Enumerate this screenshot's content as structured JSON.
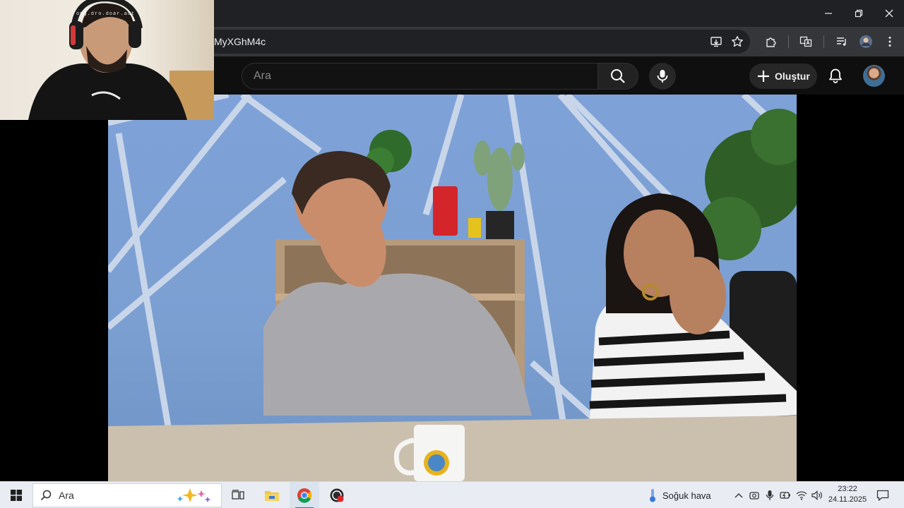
{
  "browser": {
    "url_visible": "MyXGhM4c"
  },
  "youtube": {
    "search_placeholder": "Ara",
    "create_label": "Oluştur"
  },
  "webcam": {
    "overlay_text": "ong.dro.doar.aut"
  },
  "taskbar": {
    "search_label": "Ara",
    "weather_label": "Soğuk hava",
    "time": "23:22",
    "date": "24.11.2025"
  },
  "icons": {
    "search": "search-icon",
    "mic": "microphone-icon",
    "create": "plus-icon",
    "notifications": "bell-icon",
    "extensions": "puzzle-icon",
    "bookmark": "star-icon"
  }
}
